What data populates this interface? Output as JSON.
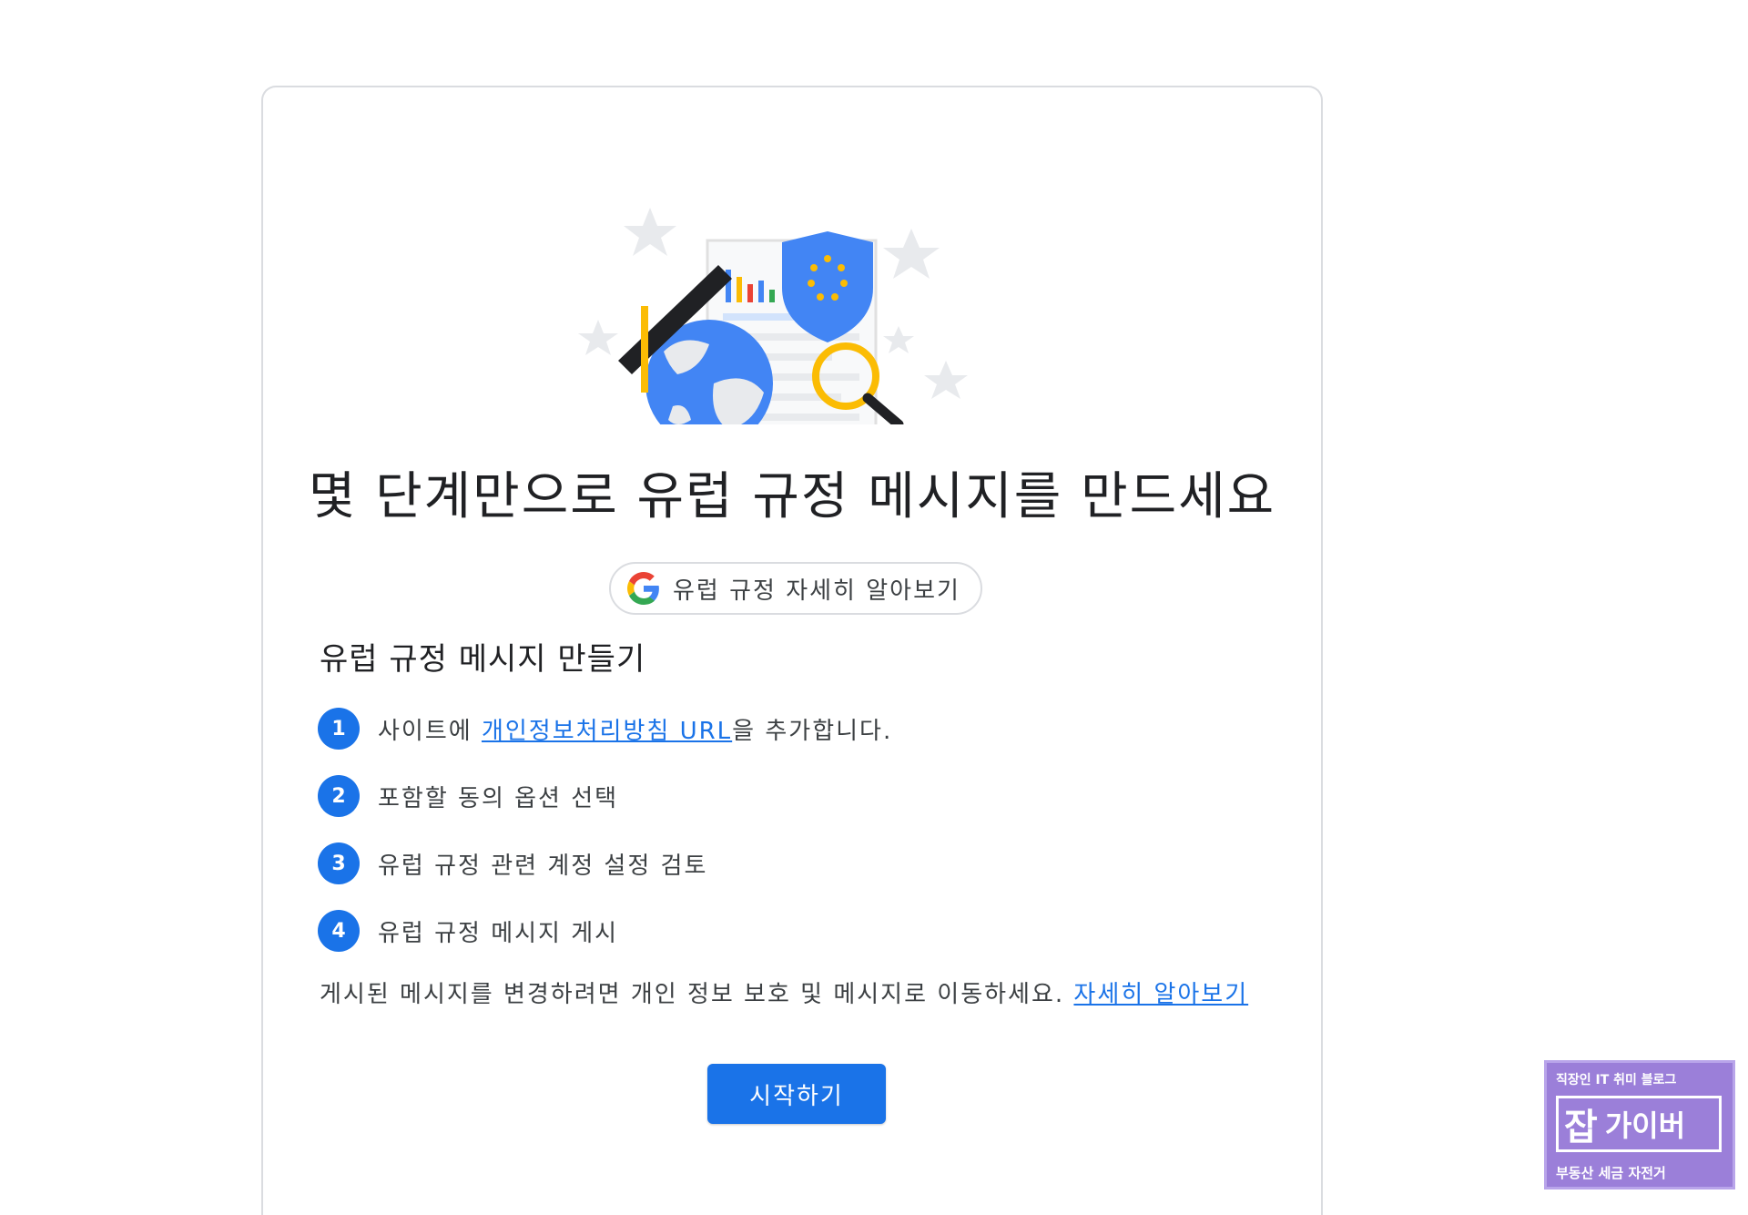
{
  "hero": {
    "image_alt": "GDPR consent illustration"
  },
  "page_title": "몇 단계만으로 유럽 규정 메시지를 만드세요",
  "learn_chip": {
    "label": "유럽 규정 자세히 알아보기",
    "icon": "google-g-icon"
  },
  "section_title": "유럽 규정 메시지 만들기",
  "steps": [
    {
      "num": "1",
      "before": "사이트에 ",
      "link": "개인정보처리방침 URL",
      "after": "을 추가합니다."
    },
    {
      "num": "2",
      "text": "포함할 동의 옵션 선택"
    },
    {
      "num": "3",
      "text": "유럽 규정 관련 계정 설정 검토"
    },
    {
      "num": "4",
      "text": "유럽 규정 메시지 게시"
    }
  ],
  "note": {
    "text": "게시된 메시지를 변경하려면 개인 정보 보호 및 메시지로 이동하세요. ",
    "link": "자세히 알아보기"
  },
  "start_button": "시작하기",
  "watermark": {
    "top": "직장인 IT 취미 블로그",
    "big": "잡",
    "name": "가이버",
    "bottom": "부동산 세금 자전거"
  },
  "colors": {
    "accent": "#1a73e8",
    "border": "#dadce0",
    "text": "#202124",
    "watermark": "#9b7fd9"
  }
}
